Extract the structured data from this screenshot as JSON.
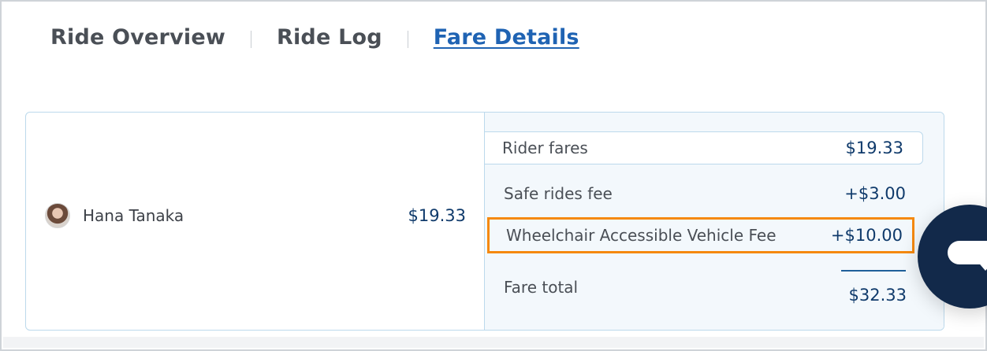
{
  "tabs": [
    {
      "label": "Ride Overview",
      "active": false
    },
    {
      "label": "Ride Log",
      "active": false
    },
    {
      "label": "Fare Details",
      "active": true
    }
  ],
  "rider": {
    "name": "Hana Tanaka",
    "amount": "$19.33"
  },
  "fare_breakdown": {
    "rider_fares": {
      "label": "Rider fares",
      "amount": "$19.33"
    },
    "safe_rides_fee": {
      "label": "Safe rides fee",
      "amount": "+$3.00"
    },
    "wav_fee": {
      "label": "Wheelchair Accessible Vehicle Fee",
      "amount": "+$10.00"
    },
    "fare_total": {
      "label": "Fare total",
      "amount": "$32.33"
    }
  },
  "icons": {
    "avatar": "avatar",
    "chat": "chat-bubble-icon"
  },
  "colors": {
    "active_tab": "#1f63b3",
    "amount_text": "#0f3a6b",
    "card_border": "#bcd9ec",
    "panel_bg": "#f3f8fc",
    "highlight_border": "#f5890f",
    "chat_fab": "#12294a"
  }
}
